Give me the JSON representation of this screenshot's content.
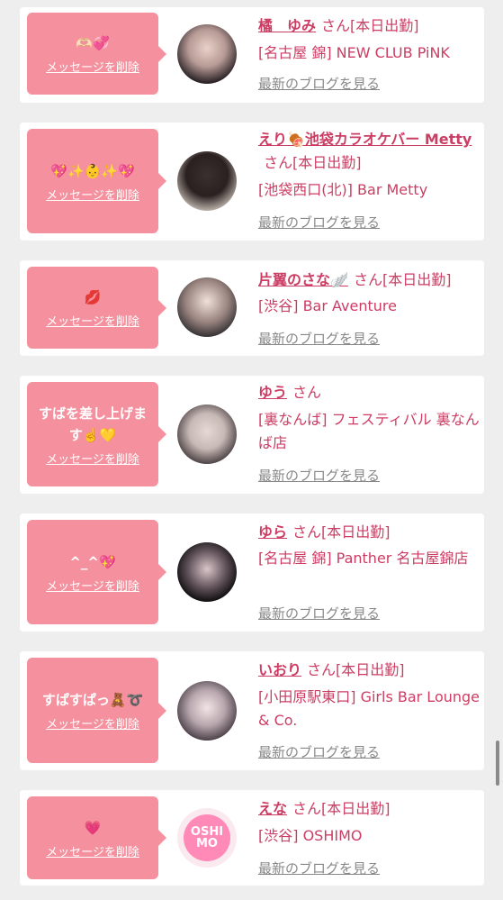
{
  "delete_label": "メッセージを削除",
  "blog_label": "最新のブログを見る",
  "san_label": "さん",
  "cards": [
    {
      "message": "🫶🏻💞",
      "name": "橘　ゆみ",
      "status": "[本日出勤]",
      "shop": "[名古屋 錦] NEW CLUB PiNK"
    },
    {
      "message": "💖✨👶✨💖",
      "name": "えり🍖池袋カラオケバー Metty",
      "status": "[本日出勤]",
      "shop": "[池袋西口(北)] Bar Metty"
    },
    {
      "message": "💋",
      "name": "片翼のさな🪽",
      "status": "[本日出勤]",
      "shop": "[渋谷] Bar Aventure"
    },
    {
      "message": "すばを差し上げます☝️💛",
      "name": "ゆう",
      "status": "",
      "shop": "[裏なんば] フェスティバル 裏なんば店"
    },
    {
      "message": "^_^💖",
      "name": "ゆら",
      "status": "[本日出勤]",
      "shop": "[名古屋 錦] Panther 名古屋錦店"
    },
    {
      "message": "すぱすぱっ🧸➰",
      "name": "いおり",
      "status": "[本日出勤]",
      "shop": "[小田原駅東口] Girls Bar Lounge & Co."
    },
    {
      "message": "💗",
      "name": "えな",
      "status": "[本日出勤]",
      "shop": "[渋谷] OSHIMO"
    }
  ],
  "avatar_logo_text": "OSHI MO",
  "colors": {
    "accent": "#cc3d63",
    "bubble": "#f5919e",
    "background": "#eeeeee"
  }
}
